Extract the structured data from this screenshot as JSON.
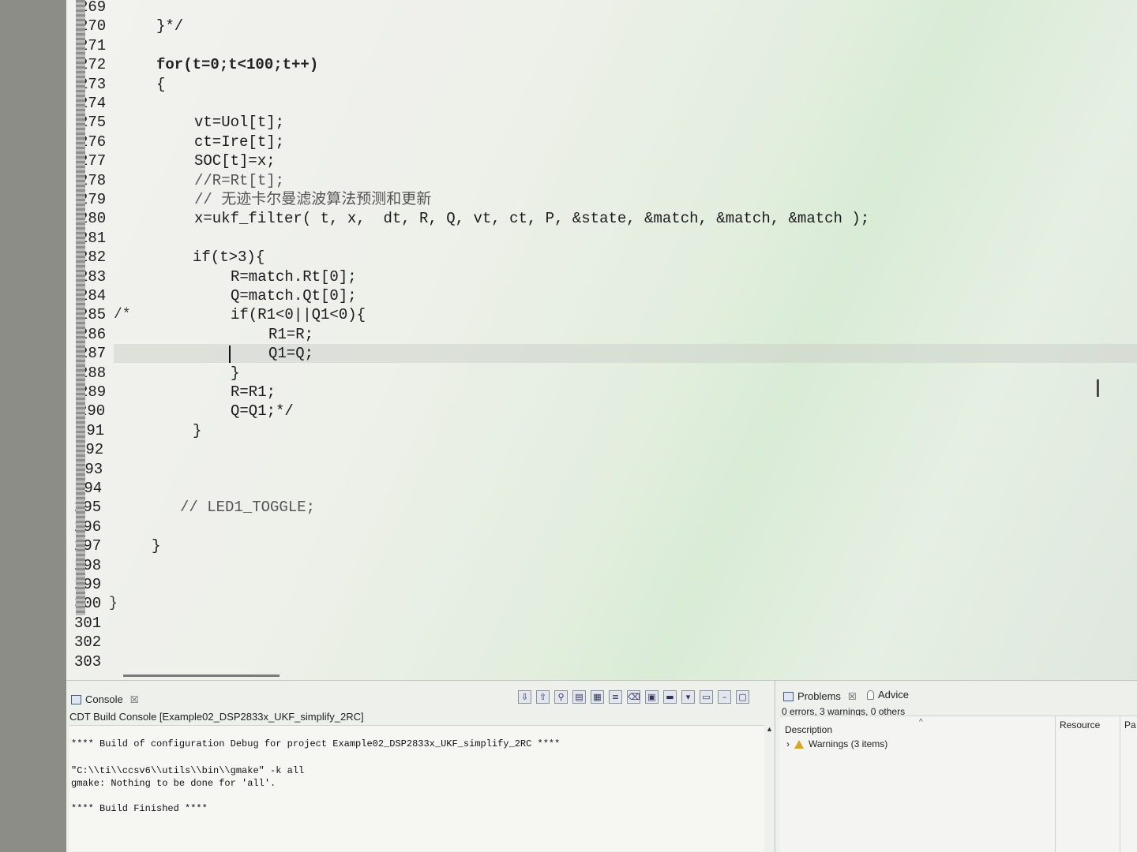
{
  "editor": {
    "lines": [
      {
        "num": "269",
        "code": ""
      },
      {
        "num": "270",
        "code": "}*/"
      },
      {
        "num": "271",
        "code": ""
      },
      {
        "num": "272",
        "code": "for(t=0;t<100;t++)"
      },
      {
        "num": "273",
        "code": "{"
      },
      {
        "num": "274",
        "code": ""
      },
      {
        "num": "275",
        "code": "vt=Uol[t];"
      },
      {
        "num": "276",
        "code": "ct=Ire[t];"
      },
      {
        "num": "277",
        "code": "SOC[t]=x;"
      },
      {
        "num": "278",
        "code": "//R=Rt[t];"
      },
      {
        "num": "279",
        "code": "// 无迹卡尔曼滤波算法预测和更新"
      },
      {
        "num": "280",
        "code": "x=ukf_filter( t, x,  dt, R, Q, vt, ct, P, &state, &match, &match, &match );"
      },
      {
        "num": "281",
        "code": ""
      },
      {
        "num": "282",
        "code": "if(t>3){"
      },
      {
        "num": "283",
        "code": "R=match.Rt[0];"
      },
      {
        "num": "284",
        "code": "Q=match.Qt[0];"
      },
      {
        "num": "285",
        "code": "if(R1<0||Q1<0){"
      },
      {
        "num": "286",
        "code": "R1=R;"
      },
      {
        "num": "287",
        "code": "Q1=Q;"
      },
      {
        "num": "288",
        "code": "}"
      },
      {
        "num": "289",
        "code": "R=R1;"
      },
      {
        "num": "290",
        "code": "Q=Q1;*/"
      },
      {
        "num": "291",
        "code": "}"
      },
      {
        "num": "292",
        "code": ""
      },
      {
        "num": "293",
        "code": ""
      },
      {
        "num": "294",
        "code": ""
      },
      {
        "num": "295",
        "code": "// LED1_TOGGLE;"
      },
      {
        "num": "296",
        "code": ""
      },
      {
        "num": "297",
        "code": "}"
      },
      {
        "num": "298",
        "code": ""
      },
      {
        "num": "299",
        "code": ""
      },
      {
        "num": "300",
        "code": ""
      },
      {
        "num": "301",
        "code": ""
      },
      {
        "num": "302",
        "code": ""
      },
      {
        "num": "303",
        "code": ""
      }
    ],
    "gutter_marks": {
      "285": "/*",
      "300": "}"
    }
  },
  "console": {
    "tab_label": "Console",
    "close_glyph": "☒",
    "subtitle": "CDT Build Console [Example02_DSP2833x_UKF_simplify_2RC]",
    "output": [
      "**** Build of configuration Debug for project Example02_DSP2833x_UKF_simplify_2RC ****",
      "",
      "\"C:\\\\ti\\\\ccsv6\\\\utils\\\\bin\\\\gmake\" -k all",
      "gmake: Nothing to be done for 'all'.",
      "",
      "**** Build Finished ****"
    ],
    "toolbar_icons": [
      "arrow-down-icon",
      "arrow-up-icon",
      "pin-icon",
      "copy-icon",
      "paste-icon",
      "word-wrap-icon",
      "clear-icon",
      "display-icon",
      "open-console-icon",
      "dropdown-icon",
      "new-console-icon",
      "minimize-icon",
      "maximize-icon"
    ]
  },
  "problems": {
    "tab_label": "Problems",
    "close_glyph": "☒",
    "advice_label": "Advice",
    "summary": "0 errors, 3 warnings, 0 others",
    "columns": {
      "description": "Description",
      "resource": "Resource",
      "path": "Pa"
    },
    "warnings_row": "Warnings (3 items)"
  }
}
